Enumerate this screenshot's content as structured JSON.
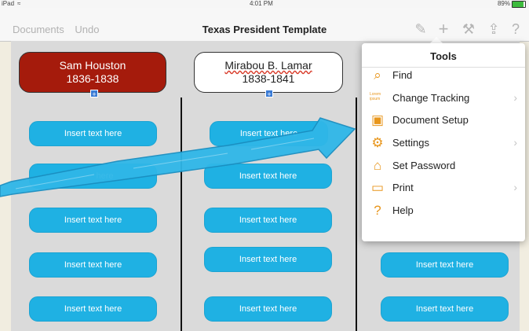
{
  "statusbar": {
    "device": "iPad",
    "wifi": "wifi",
    "time": "4:01 PM",
    "battery": "89%",
    "battery_level": 0.89
  },
  "navbar": {
    "documents": "Documents",
    "undo": "Undo",
    "title": "Texas President Template",
    "icons": [
      "pen-icon",
      "plus-icon",
      "wrench-icon",
      "share-icon",
      "help-icon"
    ],
    "icon_glyphs": {
      "pen": "✎",
      "plus": "+",
      "wrench": "⚒",
      "share": "⇪",
      "help": "?"
    }
  },
  "headers": [
    {
      "name": "Sam Houston",
      "years": "1836-1838",
      "color": "#a51b0c"
    },
    {
      "name": "Mirabou B. Lamar",
      "years": "1838-1841",
      "color": "#ffffff"
    }
  ],
  "pill_text": "Insert text here",
  "pill_color": "#1fb1e3",
  "partial_pill_text": "here",
  "tools": {
    "title": "Tools",
    "items": [
      {
        "label": "Find",
        "icon": "search-icon",
        "glyph": "◯",
        "chevron": false
      },
      {
        "label": "Change Tracking",
        "icon": "lorem-ipsum-icon",
        "glyph": "Lorem ipsum",
        "chevron": true
      },
      {
        "label": "Document Setup",
        "icon": "document-icon",
        "glyph": "▣",
        "chevron": false
      },
      {
        "label": "Settings",
        "icon": "gear-icon",
        "glyph": "⚙",
        "chevron": true
      },
      {
        "label": "Set Password",
        "icon": "lock-icon",
        "glyph": "⌂",
        "chevron": false
      },
      {
        "label": "Print",
        "icon": "printer-icon",
        "glyph": "▭",
        "chevron": true
      },
      {
        "label": "Help",
        "icon": "question-icon",
        "glyph": "?",
        "chevron": false
      }
    ],
    "chevron": "›"
  },
  "accent": "#e8961c",
  "annotation_arrow_color": "#2fb7e8"
}
